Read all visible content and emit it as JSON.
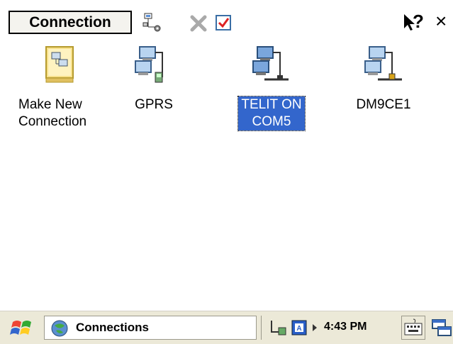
{
  "toolbar": {
    "menu_label": "Connection",
    "help_symbol": "?",
    "close_symbol": "×"
  },
  "items": [
    {
      "label_line1": "Make New",
      "label_line2": "Connection",
      "icon": "make-new-connection-icon",
      "selected": false
    },
    {
      "label_line1": "GPRS",
      "label_line2": "",
      "icon": "network-connection-icon",
      "selected": false
    },
    {
      "label_line1": "TELIT ON",
      "label_line2": "COM5",
      "icon": "network-connection-icon",
      "selected": true
    },
    {
      "label_line1": "DM9CE1",
      "label_line2": "",
      "icon": "network-connection-icon",
      "selected": false
    }
  ],
  "taskbar": {
    "task_label": "Connections",
    "clock": "4:43 PM"
  },
  "colors": {
    "selection": "#3366cc",
    "taskbar": "#ece9d8"
  }
}
